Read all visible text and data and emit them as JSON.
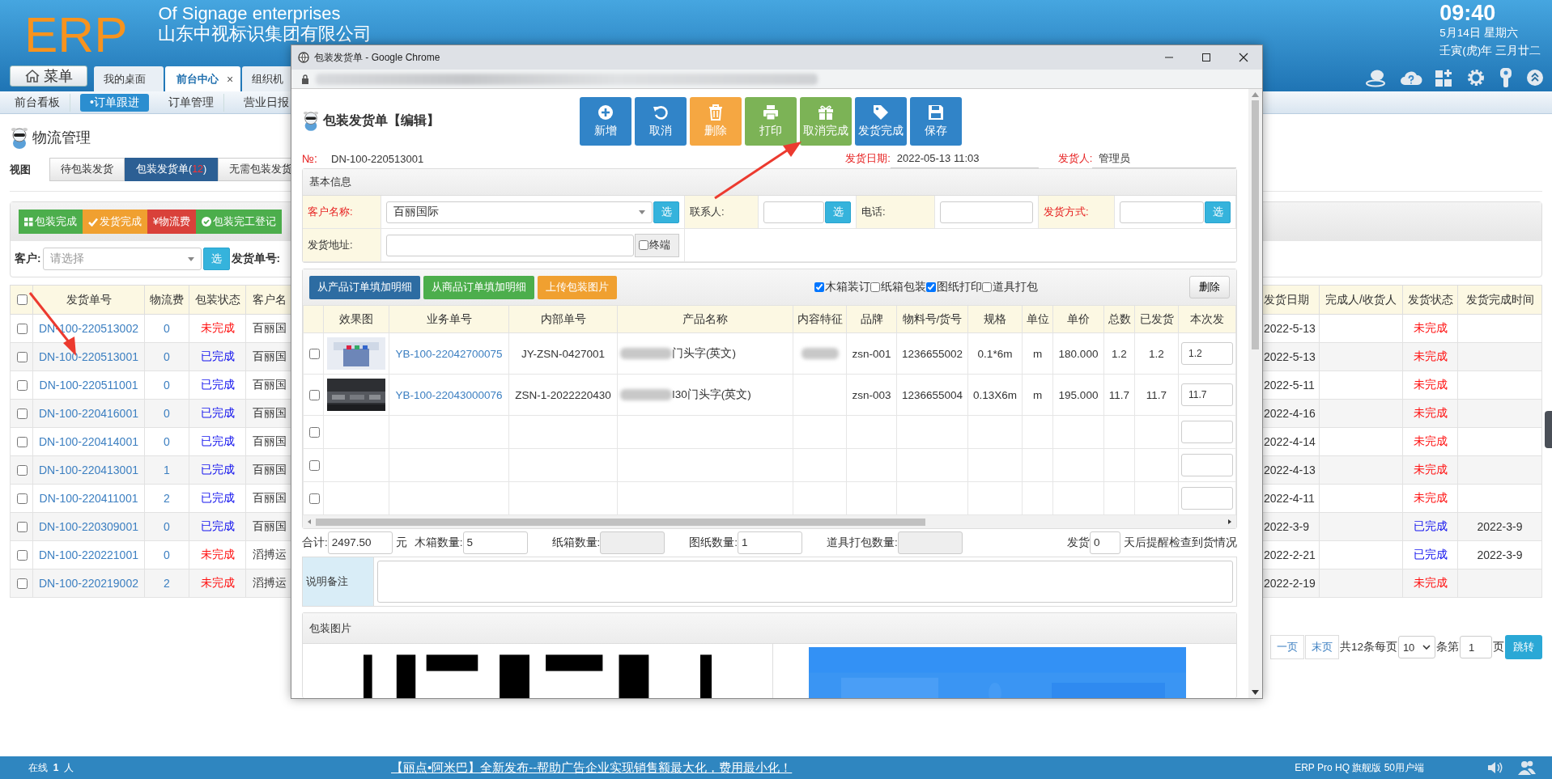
{
  "header": {
    "logo": "ERP",
    "company_en": "Of Signage enterprises",
    "company_cn": "山东中视标识集团有限公司",
    "time": "09:40",
    "date": "5月14日 星期六",
    "lunar": "壬寅(虎)年 三月廿二",
    "menu_button": "菜单"
  },
  "tabs": [
    {
      "label": "我的桌面",
      "selected": false
    },
    {
      "label": "前台中心",
      "selected": true,
      "close": "×"
    },
    {
      "label": "组织机",
      "selected": false
    }
  ],
  "subnav": [
    {
      "label": "前台看板",
      "selected": false
    },
    {
      "label": "•订单跟进",
      "selected": true
    },
    {
      "label": "订单管理",
      "selected": false
    },
    {
      "label": "营业日报",
      "selected": false
    }
  ],
  "page": {
    "title": "物流管理",
    "view_label": "视图",
    "views": [
      {
        "label": "待包装发货",
        "selected": false
      },
      {
        "label": "包装发货单(",
        "count": "12",
        "label_end": ")",
        "selected": true
      },
      {
        "label": "无需包装发货",
        "selected": false
      }
    ]
  },
  "actions": [
    {
      "label": "包装完成",
      "kind": "grid",
      "color": "#4cae4c"
    },
    {
      "label": "发货完成",
      "kind": "check",
      "color": "#f0a030"
    },
    {
      "label": "¥物流费",
      "kind": "text",
      "color": "#d9413a"
    },
    {
      "label": "包装完工登记",
      "kind": "check-circle",
      "color": "#4cae4c"
    }
  ],
  "filter": {
    "label": "客户:",
    "placeholder": "请选择",
    "pick": "选",
    "order_label": "发货单号:"
  },
  "list": {
    "all_checked": false,
    "columns": [
      "发货单号",
      "物流费",
      "包装状态",
      "客户名"
    ],
    "columns_right": [
      "发货日期",
      "完成人/收货人",
      "发货状态",
      "发货完成时间"
    ],
    "rows": [
      {
        "checked": false,
        "no": "DN-100-220513002",
        "fee": "0",
        "pack_status": "未完成",
        "pack_done": false,
        "customer": "百丽国",
        "date": "2022-5-13",
        "ship_status": "未完成",
        "ship_done": false
      },
      {
        "checked": false,
        "no": "DN-100-220513001",
        "fee": "0",
        "pack_status": "已完成",
        "pack_done": true,
        "customer": "百丽国",
        "date": "2022-5-13",
        "ship_status": "未完成",
        "ship_done": false
      },
      {
        "checked": false,
        "no": "DN-100-220511001",
        "fee": "0",
        "pack_status": "已完成",
        "pack_done": true,
        "customer": "百丽国",
        "date": "2022-5-11",
        "ship_status": "未完成",
        "ship_done": false
      },
      {
        "checked": false,
        "no": "DN-100-220416001",
        "fee": "0",
        "pack_status": "已完成",
        "pack_done": true,
        "customer": "百丽国",
        "date": "2022-4-16",
        "ship_status": "未完成",
        "ship_done": false
      },
      {
        "checked": false,
        "no": "DN-100-220414001",
        "fee": "0",
        "pack_status": "已完成",
        "pack_done": true,
        "customer": "百丽国",
        "date": "2022-4-14",
        "ship_status": "未完成",
        "ship_done": false
      },
      {
        "checked": false,
        "no": "DN-100-220413001",
        "fee": "1",
        "pack_status": "已完成",
        "pack_done": true,
        "customer": "百丽国",
        "date": "2022-4-13",
        "ship_status": "未完成",
        "ship_done": false
      },
      {
        "checked": false,
        "no": "DN-100-220411001",
        "fee": "2",
        "pack_status": "已完成",
        "pack_done": true,
        "customer": "百丽国",
        "date": "2022-4-11",
        "ship_status": "未完成",
        "ship_done": false
      },
      {
        "checked": false,
        "no": "DN-100-220309001",
        "fee": "0",
        "pack_status": "已完成",
        "pack_done": true,
        "customer": "百丽国",
        "date": "2022-3-9",
        "ship_status": "已完成",
        "ship_done": true,
        "done_time": "2022-3-9"
      },
      {
        "checked": false,
        "no": "DN-100-220221001",
        "fee": "0",
        "pack_status": "未完成",
        "pack_done": false,
        "customer": "滔搏运",
        "date": "2022-2-21",
        "ship_status": "已完成",
        "ship_done": true,
        "done_time": "2022-3-9"
      },
      {
        "checked": false,
        "no": "DN-100-220219002",
        "fee": "2",
        "pack_status": "未完成",
        "pack_done": false,
        "customer": "滔搏运",
        "date": "2022-2-19",
        "ship_status": "未完成",
        "ship_done": false
      }
    ]
  },
  "pager": {
    "prev": "一页",
    "last": "末页",
    "total": "共12条每页",
    "page_size": "10",
    "rows_label": "条第",
    "page": "1",
    "page_label": "页",
    "go": "跳转"
  },
  "modal": {
    "window_title": "包装发货单 - Google Chrome",
    "title": "包装发货单【编辑】",
    "buttons": [
      {
        "label": "新增",
        "kind": "add"
      },
      {
        "label": "取消",
        "kind": "undo"
      },
      {
        "label": "删除",
        "kind": "delete"
      },
      {
        "label": "打印",
        "kind": "print"
      },
      {
        "label": "取消完成",
        "kind": "gift"
      },
      {
        "label": "发货完成",
        "kind": "tag"
      },
      {
        "label": "保存",
        "kind": "save"
      }
    ],
    "no_label": "№:",
    "no": "DN-100-220513001",
    "date_label": "发货日期:",
    "date": "2022-05-13 11:03",
    "sender_label": "发货人:",
    "sender": "管理员",
    "basic": {
      "title": "基本信息",
      "fields": [
        {
          "label": "客户名称:",
          "required": true,
          "kind": "select",
          "value": "百丽国际",
          "pick": "选"
        },
        {
          "label": "联系人:",
          "required": false,
          "kind": "input",
          "pick": "选"
        },
        {
          "label": "电话:",
          "required": false,
          "kind": "input"
        },
        {
          "label": "发货方式:",
          "required": true,
          "kind": "input",
          "pick": "选"
        }
      ],
      "address_label": "发货地址:",
      "terminal": {
        "label": "终端",
        "checked": false
      }
    },
    "detail": {
      "buttons": [
        {
          "label": "从产品订单填加明细",
          "color": "#2d6ca2"
        },
        {
          "label": "从商品订单填加明细",
          "color": "#4cae4c"
        },
        {
          "label": "上传包装图片",
          "color": "#f0a030"
        }
      ],
      "options": [
        {
          "label": "木箱装订",
          "checked": true
        },
        {
          "label": "纸箱包装",
          "checked": false
        },
        {
          "label": "图纸打印",
          "checked": true
        },
        {
          "label": "道具打包",
          "checked": false
        }
      ],
      "delete": "删除",
      "columns": [
        "效果图",
        "业务单号",
        "内部单号",
        "产品名称",
        "内容特征",
        "品牌",
        "物料号/货号",
        "规格",
        "单位",
        "单价",
        "总数",
        "已发货",
        "本次发"
      ],
      "rows": [
        {
          "kind": "item",
          "checked": false,
          "order": "YB-100-22042700075",
          "internal": "JY-ZSN-0427001",
          "product": "门头字(英文)",
          "feature_blurred": true,
          "brand": "zsn-001",
          "material": "1236655002",
          "spec": "0.1*6m",
          "unit": "m",
          "price": "180.000",
          "total": "1.2",
          "shipped": "1.2",
          "this_ship": "1.2"
        },
        {
          "kind": "item",
          "checked": false,
          "order": "YB-100-22043000076",
          "internal": "ZSN-1-2022220430",
          "product": "I30门头字(英文)",
          "feature_blurred": false,
          "brand": "zsn-003",
          "material": "1236655004",
          "spec": "0.13X6m",
          "unit": "m",
          "price": "195.000",
          "total": "11.7",
          "shipped": "11.7",
          "this_ship": "11.7"
        },
        {
          "kind": "empty",
          "checked": false
        },
        {
          "kind": "empty",
          "checked": false
        },
        {
          "kind": "empty",
          "checked": false
        }
      ]
    },
    "totals": [
      {
        "label": "合计:",
        "value": "2497.50",
        "unit": "元",
        "disabled": false
      },
      {
        "label": "木箱数量:",
        "value": "5",
        "disabled": false
      },
      {
        "label": "纸箱数量:",
        "disabled": true
      },
      {
        "label": "图纸数量:",
        "value": "1",
        "disabled": false
      },
      {
        "label": "道具打包数量:",
        "disabled": true
      },
      {
        "label": "发货",
        "value": "0",
        "unit": "天后提醒检查到货情况",
        "disabled": false
      }
    ],
    "remark_label": "说明备注",
    "pictures_title": "包装图片"
  },
  "footer": {
    "online_label": "在线",
    "online_count": "1",
    "online_unit": "人",
    "news": "【丽点•阿米巴】全新发布--帮助广告企业实现销售额最大化，费用最小化！",
    "edition": "ERP Pro HQ 旗舰版 50用户端"
  }
}
